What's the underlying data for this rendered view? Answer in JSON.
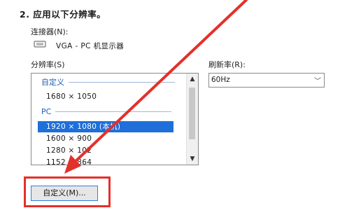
{
  "section": {
    "step_title": "2. 应用以下分辨率。"
  },
  "connector": {
    "label": "连接器(N):",
    "monitor": "VGA - PC 机显示器",
    "icon": "monitor-icon"
  },
  "resolution": {
    "label": "分辨率(S)",
    "groups": [
      {
        "name": "自定义",
        "items": [
          "1680 × 1050"
        ]
      },
      {
        "name": "PC",
        "items": [
          "1920 × 1080 (本机)",
          "1600 × 900",
          "1280 × 102",
          "1152 × 864"
        ]
      }
    ],
    "selected": "1920 × 1080 (本机)"
  },
  "refresh": {
    "label": "刷新率(R):",
    "value": "60Hz"
  },
  "buttons": {
    "custom": "自定义(M)..."
  },
  "colors": {
    "selection": "#1e6fd9",
    "annotation": "#e4302a",
    "group_header": "#1f5fb5"
  }
}
